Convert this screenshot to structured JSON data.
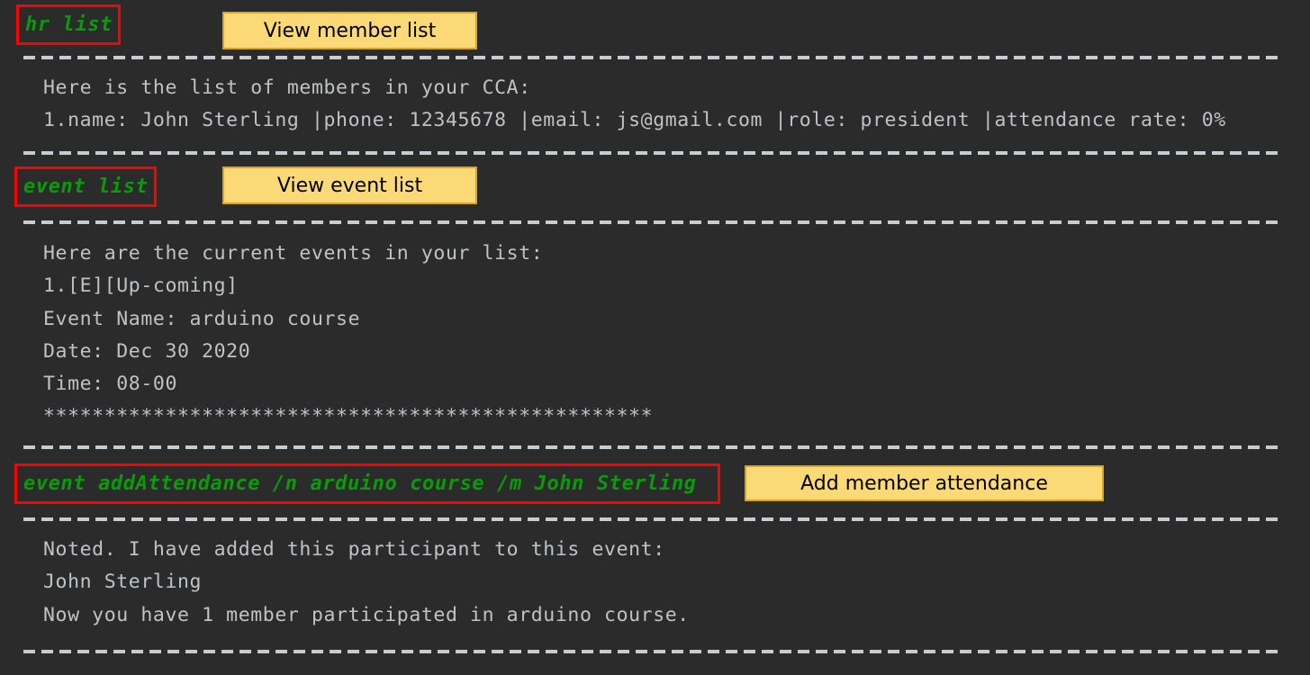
{
  "app": {
    "background_color": "#2b2b2b",
    "text_color": "#bfc3c6",
    "command_color": "#0a9b0a",
    "highlight_border_color": "#ff0000",
    "annotation_fill_color": "#fad976",
    "annotation_border_color": "#d9a520"
  },
  "sections": {
    "member_list": {
      "command": "hr list",
      "annotation": "View member list",
      "output": [
        "Here is the list of members in your CCA:",
        "1.name: John Sterling |phone: 12345678 |email: js@gmail.com |role: president |attendance rate: 0%"
      ]
    },
    "event_list": {
      "command": "event list",
      "annotation": "View event list",
      "output": [
        "Here are the current events in your list:",
        "1.[E][Up-coming]",
        "Event Name: arduino course",
        "Date: Dec 30 2020",
        "Time: 08-00",
        "**************************************************"
      ]
    },
    "add_attendance": {
      "command": "event addAttendance /n arduino course /m John Sterling",
      "annotation": "Add member attendance",
      "output": [
        "Noted. I have added this participant to this event:",
        "John Sterling",
        "Now you have 1 member participated in arduino course."
      ]
    }
  }
}
